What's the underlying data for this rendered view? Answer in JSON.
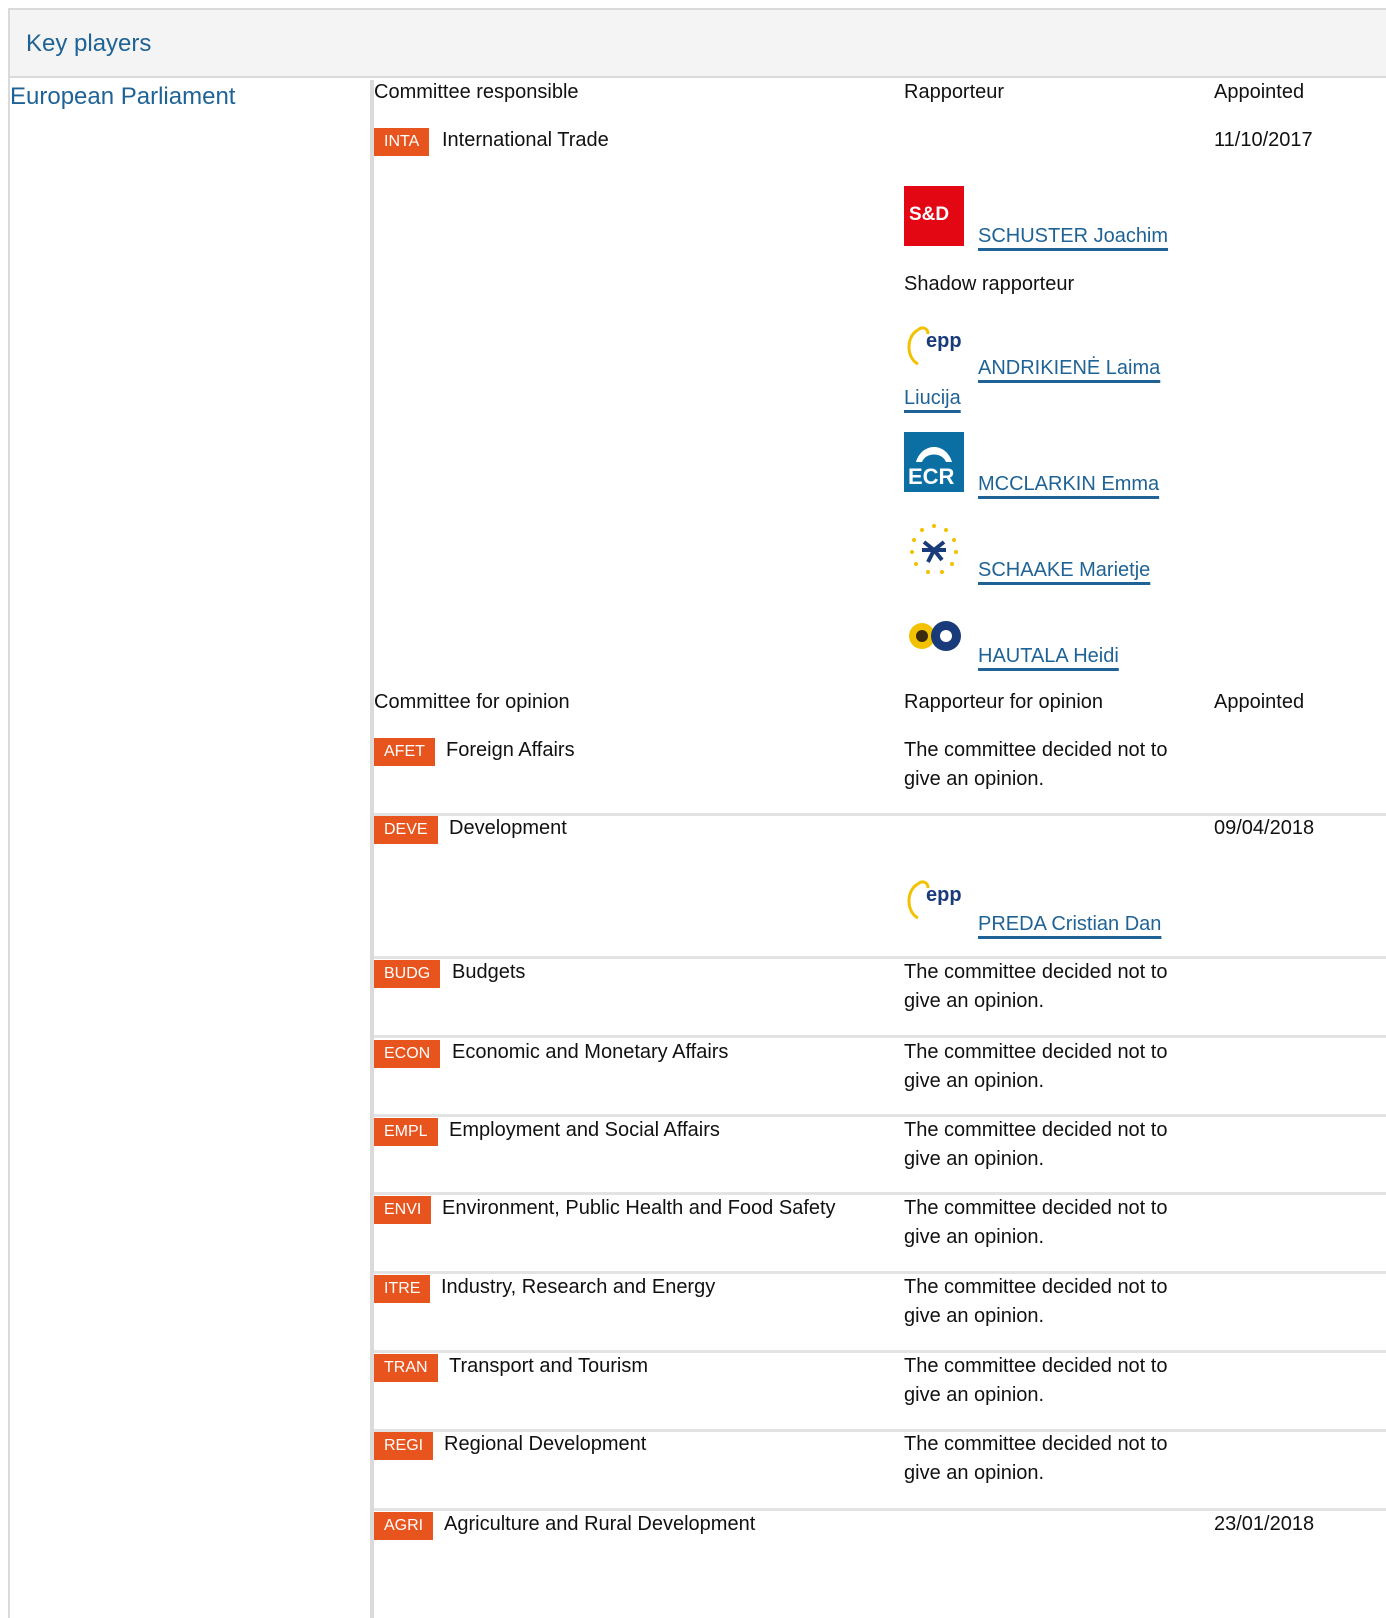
{
  "header": {
    "title": "Key players"
  },
  "institution": "European Parliament",
  "responsible": {
    "col_committee": "Committee responsible",
    "col_rapporteur": "Rapporteur",
    "col_appointed": "Appointed",
    "committee": {
      "code": "INTA",
      "name": "International Trade",
      "date": "11/10/2017"
    },
    "rapporteur": {
      "group": "S&D",
      "name": "SCHUSTER Joachim"
    },
    "shadow_label": "Shadow rapporteur",
    "shadows": [
      {
        "group": "epp",
        "name_line1": "ANDRIKIENĖ Laima",
        "name_line2": "Liucija"
      },
      {
        "group": "ECR",
        "name": "MCCLARKIN Emma"
      },
      {
        "group": "ALDE",
        "name": "SCHAAKE Marietje"
      },
      {
        "group": "Greens",
        "name": "HAUTALA Heidi"
      }
    ]
  },
  "opinion": {
    "col_committee": "Committee for opinion",
    "col_rapporteur": "Rapporteur for opinion",
    "col_appointed": "Appointed",
    "no_opinion_line1": "The committee decided not to",
    "no_opinion_line2": "give an opinion.",
    "committees": [
      {
        "code": "AFET",
        "name": "Foreign Affairs"
      },
      {
        "code": "DEVE",
        "name": "Development",
        "date": "09/04/2018",
        "rapporteur": {
          "group": "epp",
          "name": "PREDA Cristian Dan"
        }
      },
      {
        "code": "BUDG",
        "name": "Budgets"
      },
      {
        "code": "ECON",
        "name": "Economic and Monetary Affairs"
      },
      {
        "code": "EMPL",
        "name": "Employment and Social Affairs"
      },
      {
        "code": "ENVI",
        "name": "Environment, Public Health and Food Safety"
      },
      {
        "code": "ITRE",
        "name": "Industry, Research and Energy"
      },
      {
        "code": "TRAN",
        "name": "Transport and Tourism"
      },
      {
        "code": "REGI",
        "name": "Regional Development"
      },
      {
        "code": "AGRI",
        "name": "Agriculture and Rural Development",
        "date": "23/01/2018"
      }
    ]
  },
  "colors": {
    "badge": "#e8541d",
    "link": "#1f6396",
    "sd_red": "#e30613",
    "ecr_blue": "#0b6fa4"
  }
}
